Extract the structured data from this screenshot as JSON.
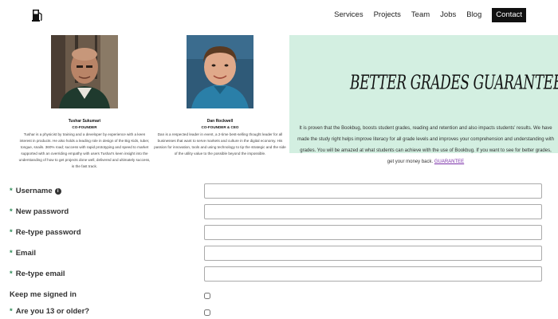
{
  "nav": {
    "logo_icon": "fuel-pump-icon",
    "items": [
      "Services",
      "Projects",
      "Team",
      "Jobs",
      "Blog"
    ],
    "contact": "Contact"
  },
  "team": [
    {
      "name": "Tushar Sukumari",
      "role": "CO-FOUNDER",
      "bio": "Tushar is a physicist by training and a developer by experience with a keen interest in products. He also holds a leading role in design of the Big Kids, tuber, tongue, snails. 360% road; success with rapid prototyping and speed to market supported with an overriding empathy with users Tushar's keen insight into the understanding of how to get projects done well, delivered and ultimately success, is the fast track."
    },
    {
      "name": "Dan Rockwell",
      "role": "CO-FOUNDER & CEO",
      "bio": "Dan is a respected leader in event, a 2-time best-selling thought leader for all businesses that want to serve markets and culture in the digital economy. His passion for innovation, tools and using technology to tip the strategic and the side of the utility value to the possible beyond the impossible."
    }
  ],
  "promo": {
    "title": "BETTER GRADES GUARANTEED",
    "text": "It is proven that the Bookbug, boosts student grades, reading and retention and also impacts students' results. We have made the study right helps improve literacy for all grade levels and improves your comprehension and understanding with grades. You will be amazed at what students can achieve with the use of Bookbug. If you want to see for better grades, get your money back.",
    "link": "GUARANTEE"
  },
  "form": {
    "username": "Username",
    "new_password": "New password",
    "retype_password": "Re-type password",
    "email": "Email",
    "retype_email": "Re-type email",
    "keep_signed_in": "Keep me signed in",
    "age_check": "Are you 13 or older?",
    "required_marker": "*",
    "info_icon": "info-icon"
  },
  "colors": {
    "accent_green": "#2e8b57",
    "promo_bg": "#d3efe1",
    "link_purple": "#7a2fa8",
    "nav_active_bg": "#111111"
  }
}
